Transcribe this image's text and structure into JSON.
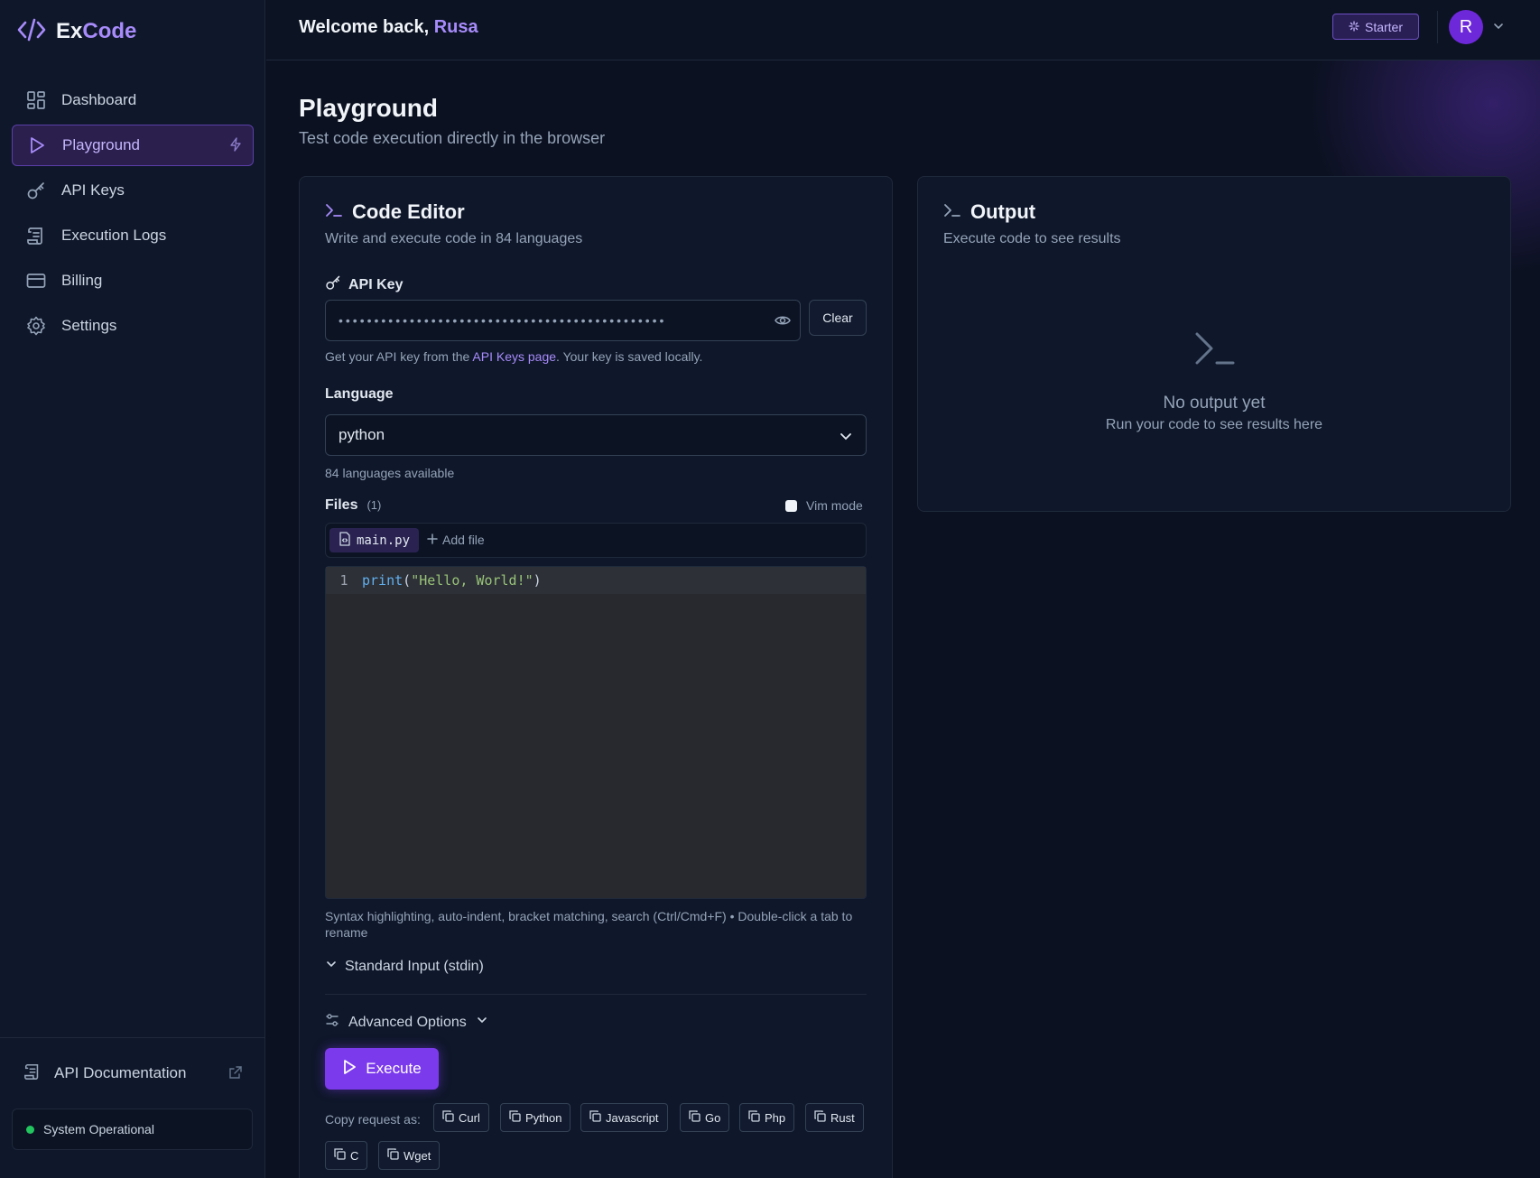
{
  "brand": {
    "name_part1": "Ex",
    "name_part2": "Code"
  },
  "sidebar": {
    "items": [
      {
        "label": "Dashboard",
        "icon": "dashboard-icon"
      },
      {
        "label": "Playground",
        "icon": "play-icon",
        "active": true
      },
      {
        "label": "API Keys",
        "icon": "key-icon"
      },
      {
        "label": "Execution Logs",
        "icon": "logs-icon"
      },
      {
        "label": "Billing",
        "icon": "card-icon"
      },
      {
        "label": "Settings",
        "icon": "gear-icon"
      }
    ],
    "docs_label": "API Documentation",
    "status_label": "System Operational"
  },
  "header": {
    "welcome_prefix": "Welcome back,",
    "user_name": "Rusa",
    "plan": "Starter",
    "avatar_letter": "R"
  },
  "page": {
    "title": "Playground",
    "subtitle": "Test code execution directly in the browser"
  },
  "editor": {
    "title": "Code Editor",
    "subtitle": "Write and execute code in 84 languages",
    "api_key_label": "API Key",
    "api_key_value": "••••••••••••••••••••••••••••••••••••••••••••••",
    "clear_label": "Clear",
    "hint_prefix": "Get your API key from the",
    "hint_link": "API Keys page",
    "hint_suffix": ". Your key is saved locally.",
    "language_label": "Language",
    "language_value": "python",
    "language_count": "84 languages available",
    "files_label": "Files",
    "files_count": "(1)",
    "vim_label": "Vim mode",
    "file_tab": "main.py",
    "add_file": "Add file",
    "code": {
      "line_no": "1",
      "fn": "print",
      "open": "(",
      "str": "\"Hello, World!\"",
      "close": ")"
    },
    "editor_hint": "Syntax highlighting, auto-indent, bracket matching, search (Ctrl/Cmd+F) • Double-click a tab to rename",
    "stdin_label": "Standard Input (stdin)",
    "advanced_label": "Advanced Options",
    "execute_label": "Execute",
    "copy_label": "Copy request as:",
    "copy_options": [
      "Curl",
      "Python",
      "Javascript",
      "Go",
      "Php",
      "Rust",
      "C",
      "Wget"
    ]
  },
  "output": {
    "title": "Output",
    "subtitle": "Execute code to see results",
    "empty_title": "No output yet",
    "empty_sub": "Run your code to see results here"
  },
  "colors": {
    "accent": "#7c3aed",
    "accent_text": "#a78bfa",
    "status": "#22c55e"
  }
}
